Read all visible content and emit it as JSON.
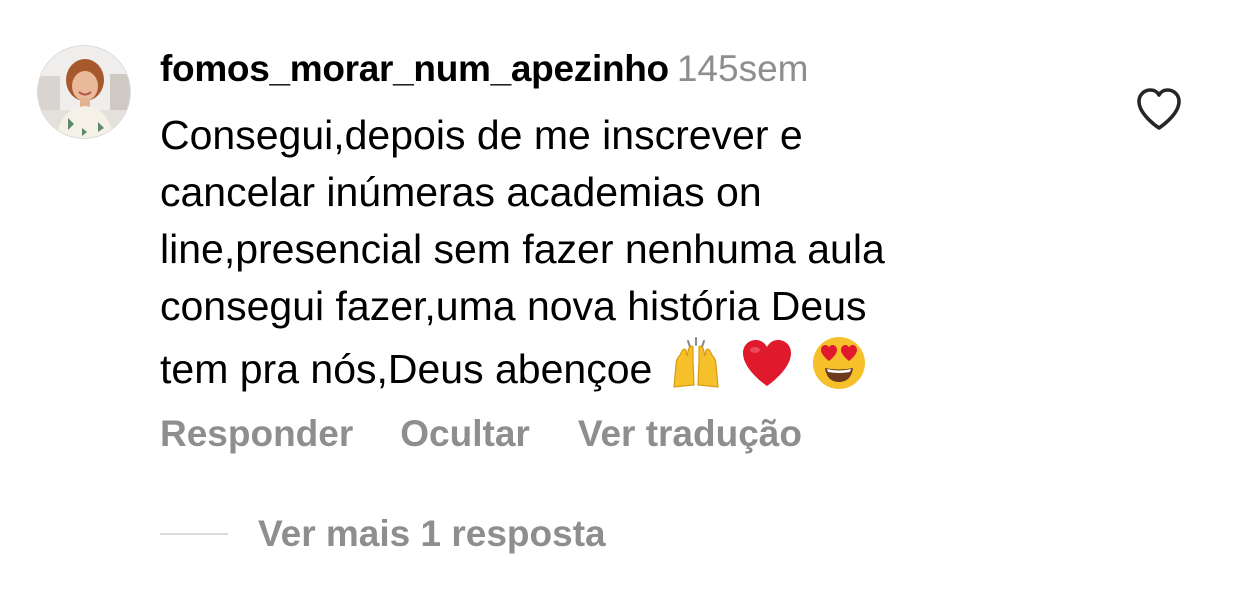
{
  "comment": {
    "username": "fomos_morar_num_apezinho",
    "timestamp": "145sem",
    "text_lines": [
      "Consegui,depois de me inscrever e",
      "cancelar inúmeras academias on",
      "line,presencial sem fazer nenhuma aula",
      "consegui fazer,uma nova história Deus",
      "tem pra nós,Deus abençoe"
    ],
    "emojis": [
      "raising-hands-emoji",
      "red-heart-emoji",
      "heart-eyes-emoji"
    ],
    "actions": {
      "reply": "Responder",
      "hide": "Ocultar",
      "translate": "Ver tradução"
    },
    "view_replies": "Ver mais 1 resposta",
    "like_icon": "heart-outline-icon",
    "avatar_icon": "profile-photo"
  },
  "colors": {
    "text": "#000000",
    "secondary": "#8e8e8e",
    "divider": "#dbdbdb",
    "heart_emoji": "#e0192d",
    "smiley": "#f6c02a"
  }
}
